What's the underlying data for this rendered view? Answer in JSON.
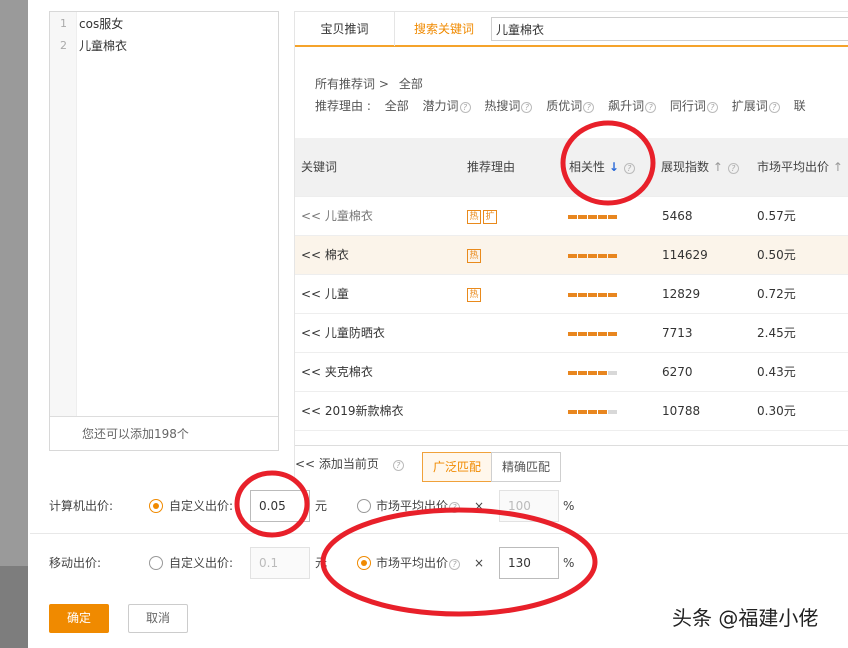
{
  "keyword_list": {
    "items": [
      {
        "num": "1",
        "text": "cos服女"
      },
      {
        "num": "2",
        "text": "儿童棉衣"
      }
    ],
    "footer": "您还可以添加198个"
  },
  "tabs": [
    {
      "label": "宝贝推词"
    },
    {
      "label": "搜索关键词"
    }
  ],
  "search": {
    "value": "儿童棉衣"
  },
  "filters": {
    "all_label": "所有推荐词 >",
    "all_value": "全部",
    "reason_label": "推荐理由 :",
    "reasons": [
      "全部",
      "潜力词",
      "热搜词",
      "质优词",
      "飙升词",
      "同行词",
      "扩展词",
      "联"
    ]
  },
  "table": {
    "headers": {
      "keyword": "关键词",
      "reason": "推荐理由",
      "relevance": "相关性",
      "impressions": "展现指数",
      "avg_bid": "市场平均出价"
    },
    "rows": [
      {
        "keyword": "<< 儿童棉衣",
        "tags": [
          "热",
          "扩"
        ],
        "relevance": 5,
        "impressions": "5468",
        "avg_bid": "0.57元",
        "greyed": true
      },
      {
        "keyword": "<< 棉衣",
        "tags": [
          "热"
        ],
        "relevance": 5,
        "impressions": "114629",
        "avg_bid": "0.50元",
        "highlight": true
      },
      {
        "keyword": "<< 儿童",
        "tags": [
          "热"
        ],
        "relevance": 5,
        "impressions": "12829",
        "avg_bid": "0.72元"
      },
      {
        "keyword": "<< 儿童防晒衣",
        "tags": [],
        "relevance": 5,
        "impressions": "7713",
        "avg_bid": "2.45元"
      },
      {
        "keyword": "<< 夹克棉衣",
        "tags": [],
        "relevance": 4,
        "impressions": "6270",
        "avg_bid": "0.43元"
      },
      {
        "keyword": "<< 2019新款棉衣",
        "tags": [],
        "relevance": 4,
        "impressions": "10788",
        "avg_bid": "0.30元"
      }
    ]
  },
  "bottom": {
    "add_page": "<< 添加当前页",
    "broad": "广泛匹配",
    "exact": "精确匹配"
  },
  "pc_bid": {
    "label": "计算机出价:",
    "custom_label": "自定义出价:",
    "custom_value": "0.05",
    "unit": "元",
    "market_label": "市场平均出价",
    "times": "×",
    "percent_value": "100",
    "percent": "%"
  },
  "mobile_bid": {
    "label": "移动出价:",
    "custom_label": "自定义出价:",
    "custom_value": "0.1",
    "unit": "元",
    "market_label": "市场平均出价",
    "times": "×",
    "percent_value": "130",
    "percent": "%"
  },
  "buttons": {
    "ok": "确定",
    "cancel": "取消"
  },
  "watermark": "头条 @福建小佬",
  "colors": {
    "accent": "#f08a00",
    "annotation": "#e8202a"
  }
}
